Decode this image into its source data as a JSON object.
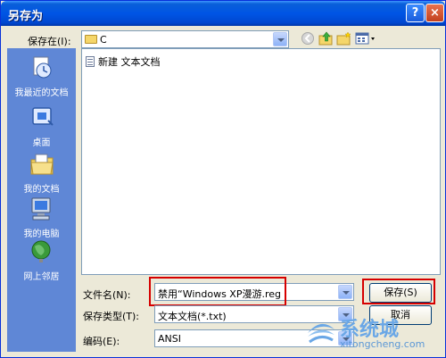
{
  "window": {
    "title": "另存为"
  },
  "titlebar": {
    "help": "?",
    "close": "×"
  },
  "location": {
    "label": "保存在(I):",
    "value": "C"
  },
  "places": [
    {
      "label": "我最近的文档",
      "icon": "recent-docs-icon"
    },
    {
      "label": "桌面",
      "icon": "desktop-icon"
    },
    {
      "label": "我的文档",
      "icon": "my-documents-icon"
    },
    {
      "label": "我的电脑",
      "icon": "my-computer-icon"
    },
    {
      "label": "网上邻居",
      "icon": "network-icon"
    }
  ],
  "files": [
    {
      "name": "新建 文本文档",
      "icon": "text-document-icon"
    }
  ],
  "form": {
    "filename_label": "文件名(N):",
    "filename_value": "禁用“Windows XP漫游.reg",
    "type_label": "保存类型(T):",
    "type_value": "文本文档(*.txt)",
    "encoding_label": "编码(E):",
    "encoding_value": "ANSI"
  },
  "buttons": {
    "save": "保存(S)",
    "cancel": "取消"
  },
  "watermark": {
    "title": "系统城",
    "url": "xitongcheng.com"
  },
  "colors": {
    "titlebar": "#0055e5",
    "places_bar": "#5f87d6",
    "highlight": "#d60000",
    "dialog": "#ece9d8"
  }
}
